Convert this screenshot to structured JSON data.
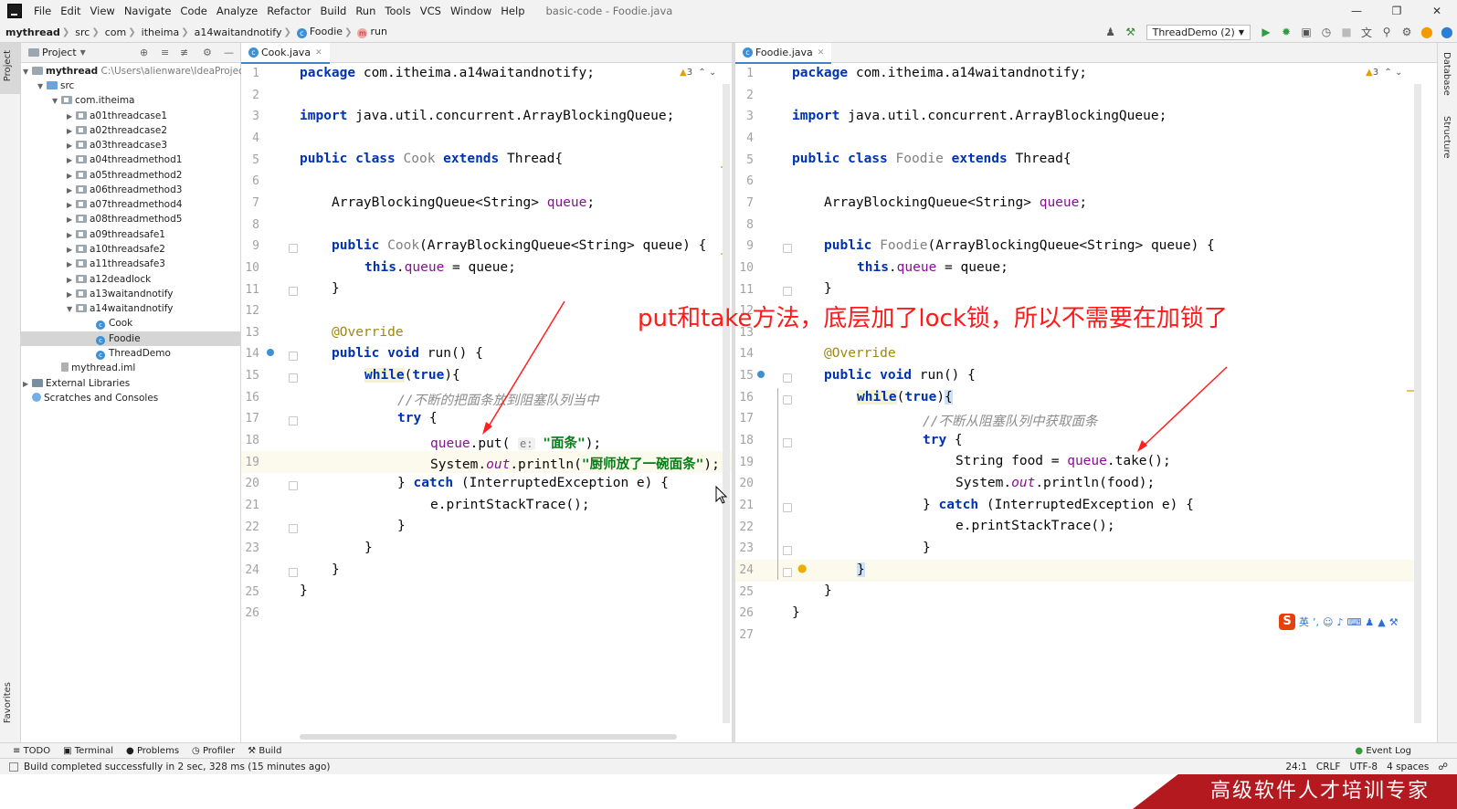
{
  "menu": {
    "items": [
      "File",
      "Edit",
      "View",
      "Navigate",
      "Code",
      "Analyze",
      "Refactor",
      "Build",
      "Run",
      "Tools",
      "VCS",
      "Window",
      "Help"
    ],
    "window_title": "basic-code - Foodie.java"
  },
  "nav": {
    "crumbs": [
      "mythread",
      "src",
      "com",
      "itheima",
      "a14waitandnotify",
      "Foodie",
      "run"
    ],
    "run_config": "ThreadDemo (2)"
  },
  "project": {
    "header": "Project",
    "root_name": "mythread",
    "root_path": "C:\\Users\\alienware\\IdeaProjects\\",
    "src": "src",
    "package": "com.itheima",
    "folders": [
      "a01threadcase1",
      "a02threadcase2",
      "a03threadcase3",
      "a04threadmethod1",
      "a05threadmethod2",
      "a06threadmethod3",
      "a07threadmethod4",
      "a08threadmethod5",
      "a09threadsafe1",
      "a10threadsafe2",
      "a11threadsafe3",
      "a12deadlock",
      "a13waitandnotify",
      "a14waitandnotify"
    ],
    "classes": [
      "Cook",
      "Foodie",
      "ThreadDemo"
    ],
    "iml": "mythread.iml",
    "external": "External Libraries",
    "scratches": "Scratches and Consoles"
  },
  "left_tabs": {
    "project": "Project",
    "favorites": "Favorites"
  },
  "right_tabs": {
    "database": "Database",
    "structure": "Structure"
  },
  "editor_left": {
    "tab": "Cook.java",
    "warnings": "3",
    "lines": [
      "1",
      "2",
      "3",
      "4",
      "5",
      "6",
      "7",
      "8",
      "9",
      "10",
      "11",
      "12",
      "13",
      "14",
      "15",
      "16",
      "17",
      "18",
      "19",
      "20",
      "21",
      "22",
      "23",
      "24",
      "25",
      "26"
    ],
    "package_stmt": "com.itheima.a14waitandnotify;",
    "import_stmt": "java.util.concurrent.ArrayBlockingQueue;",
    "class_name": "Cook",
    "super_class": "Thread{",
    "field_type": "ArrayBlockingQueue<String>",
    "field_name": "queue",
    "ctor_params": "(ArrayBlockingQueue<String> queue) {",
    "comment": "//不断的把面条放到阻塞队列当中",
    "put_hint": "e:",
    "put_arg": "\"面条\"",
    "println_arg": "\"厨师放了一碗面条\""
  },
  "editor_right": {
    "tab": "Foodie.java",
    "warnings": "3",
    "lines": [
      "1",
      "2",
      "3",
      "4",
      "5",
      "6",
      "7",
      "8",
      "9",
      "10",
      "11",
      "12",
      "13",
      "14",
      "15",
      "16",
      "17",
      "18",
      "19",
      "20",
      "21",
      "22",
      "23",
      "24",
      "25",
      "26",
      "27"
    ],
    "class_name": "Foodie",
    "comment": "//不断从阻塞队列中获取面条"
  },
  "overlay_note": "put和take方法，底层加了lock锁，所以不需要在加锁了",
  "tool_tabs": [
    "TODO",
    "Terminal",
    "Problems",
    "Profiler",
    "Build"
  ],
  "event_log": "Event Log",
  "status": {
    "message": "Build completed successfully in 2 sec, 328 ms (15 minutes ago)",
    "position": "24:1",
    "line_sep": "CRLF",
    "encoding": "UTF-8",
    "indent": "4 spaces"
  },
  "banner": "高级软件人才培训专家",
  "ime": {
    "lang": "英"
  }
}
